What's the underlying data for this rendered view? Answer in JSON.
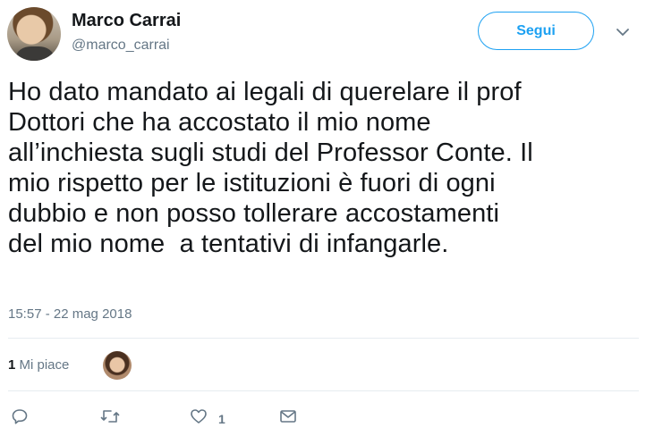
{
  "author": {
    "name": "Marco Carrai",
    "handle": "@marco_carrai"
  },
  "follow_label": "Segui",
  "tweet": {
    "text": "Ho dato mandato ai legali di querelare il prof\nDottori che ha accostato il mio nome\nall’inchiesta sugli studi del Professor Conte. Il\nmio rispetto per le istituzioni è fuori di ogni\ndubbio e non posso tollerare accostamenti\ndel mio nome  a tentativi di infangarle.",
    "timestamp": "15:57 - 22 mag 2018"
  },
  "likes": {
    "count": "1",
    "label": " Mi piace"
  },
  "actions": {
    "reply_icon": "reply-icon",
    "retweet_icon": "retweet-icon",
    "like_icon": "heart-icon",
    "like_count": "1",
    "dm_icon": "envelope-icon"
  },
  "colors": {
    "accent": "#1da1f2",
    "secondary_text": "#657786",
    "divider": "#e6ecf0"
  }
}
